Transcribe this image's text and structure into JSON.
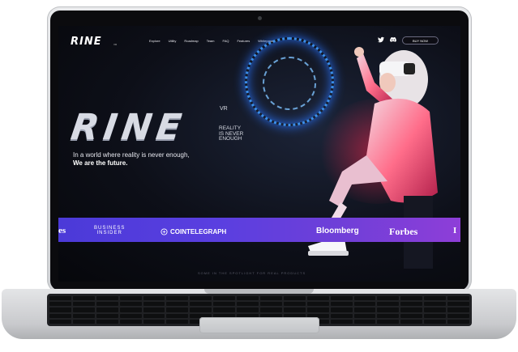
{
  "site": {
    "logo": "RINE",
    "logo_sub": "VR",
    "nav_links": [
      "Explore",
      "Utility",
      "Roadmap",
      "Team",
      "FAQ",
      "Features",
      "Whitepaper"
    ],
    "buy_label": "BUY NOW",
    "hero": {
      "title": "RINE",
      "vr": "VR",
      "tagline_1": "REALITY",
      "tagline_2": "IS NEVER",
      "tagline_3": "ENOUGH",
      "subtitle": "In a world where reality is never enough,",
      "subtitle_bold": "We are the future."
    },
    "press": {
      "left_edge": "es",
      "business_insider_1": "BUSINESS",
      "business_insider_2": "INSIDER",
      "cointelegraph": "COINTELEGRAPH",
      "bloomberg": "Bloomberg",
      "forbes": "Forbes",
      "right_edge": "I"
    },
    "footer_text": "SOME IN THE SPOTLIGHT FOR REAL PRODUCTS"
  },
  "icons": {
    "twitter": "twitter-icon",
    "discord": "discord-icon",
    "coin": "cointelegraph-icon"
  },
  "colors": {
    "band_start": "#4b3ad8",
    "band_end": "#8e3ed8",
    "ring": "#3f9cff",
    "glow": "#ff2850"
  }
}
